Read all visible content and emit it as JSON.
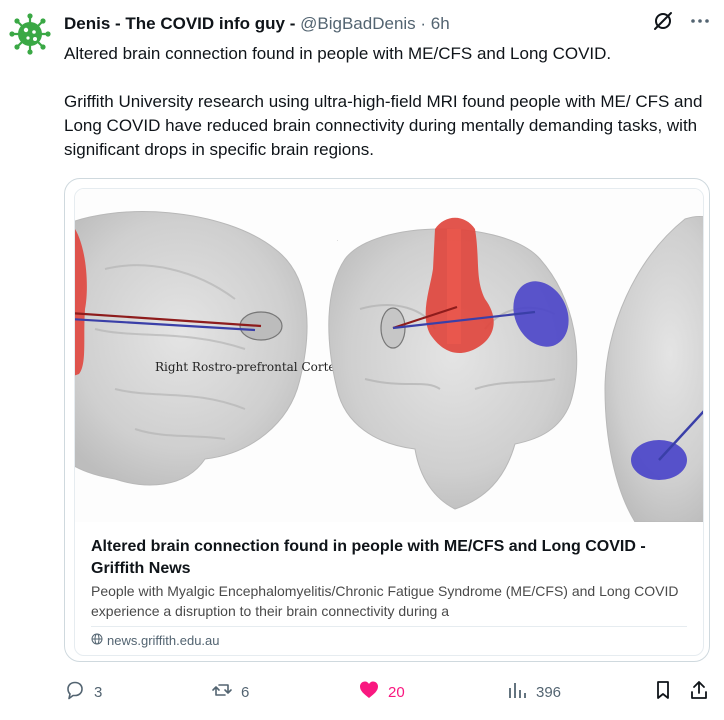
{
  "author": {
    "display_name": "Denis - The COVID info guy -",
    "handle": "@BigBadDenis",
    "time": "6h",
    "avatar_icon": "virus-icon",
    "avatar_color": "#3aa845"
  },
  "header_icons": [
    "grok-icon",
    "more-icon"
  ],
  "tweet": {
    "line1": "Altered brain connection found in people with ME/CFS and Long COVID.",
    "paragraph2": "Griffith University research using ultra-high-field MRI found people with ME/ CFS and Long COVID have reduced brain connectivity during mentally demanding tasks, with significant drops in specific brain regions."
  },
  "card": {
    "image_label": "Right Rostro-prefrontal Cortex",
    "title": "Altered brain connection found in people with ME/CFS and Long COVID - Griffith News",
    "description": "People with Myalgic Encephalomyelitis/Chronic Fatigue Syndrome (ME/CFS) and Long COVID experience a disruption to their brain connectivity during a",
    "domain": "news.griffith.edu.au"
  },
  "actions": {
    "replies": "3",
    "reposts": "6",
    "likes": "20",
    "views": "396",
    "like_color": "#f91880"
  }
}
